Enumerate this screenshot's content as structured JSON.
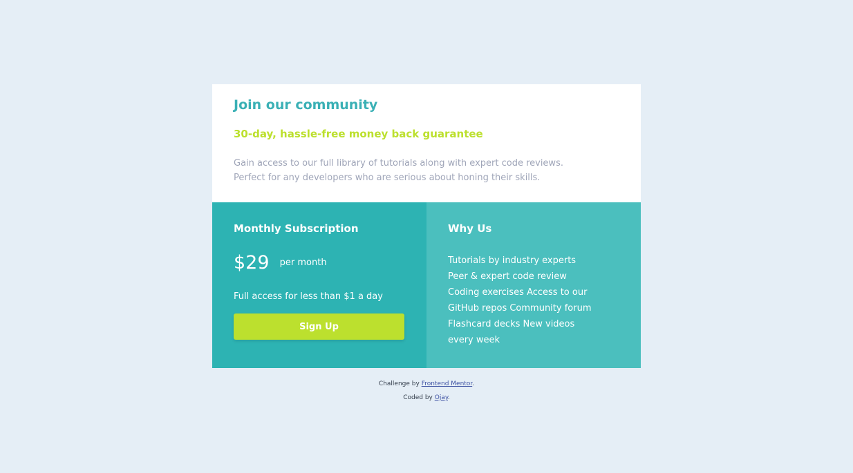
{
  "card": {
    "title": "Join our community",
    "guarantee": "30-day, hassle-free money back guarantee",
    "description": [
      "Gain access to our full library of tutorials along with expert code reviews.",
      "Perfect for any developers who are serious about honing their skills."
    ]
  },
  "monthly": {
    "title": "Monthly Subscription",
    "price": "$29",
    "period": "per month",
    "access": "Full access for less than $1 a day",
    "button": "Sign Up"
  },
  "why": {
    "title": "Why Us",
    "lines": [
      "Tutorials by industry experts",
      "Peer & expert code review",
      "Coding exercises Access to our",
      "GitHub repos Community forum",
      "Flashcard decks New videos",
      "every week"
    ]
  },
  "attribution": {
    "challenge_prefix": "Challenge by ",
    "challenge_link": "Frontend Mentor",
    "challenge_suffix": ".",
    "coded_prefix": "Coded by ",
    "coded_link": "Ojay",
    "coded_suffix": "."
  },
  "colors": {
    "background": "#e5eef6",
    "accent_teal": "#3ab0b5",
    "accent_lime": "#bce02e",
    "monthly_bg": "#2db3b3",
    "why_bg": "#4bbfbe"
  }
}
